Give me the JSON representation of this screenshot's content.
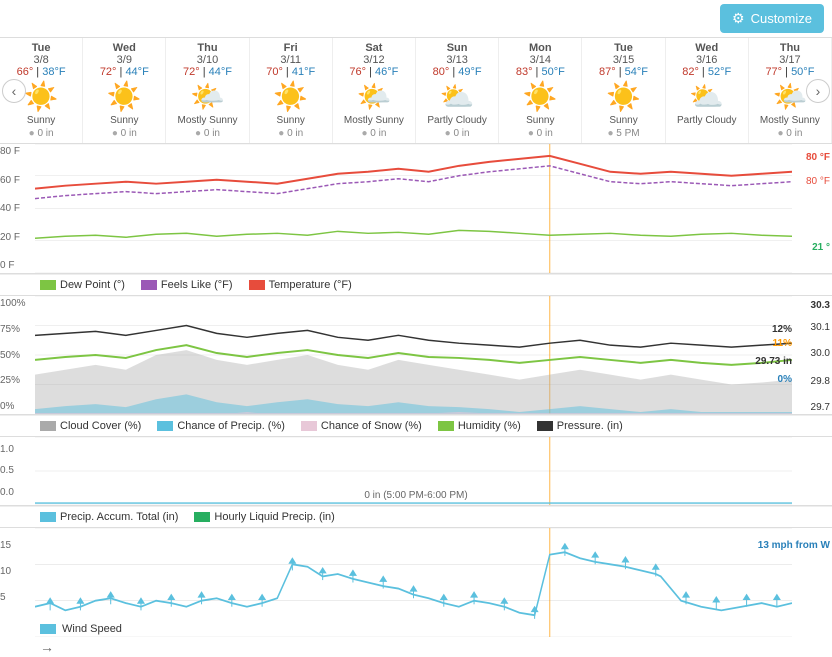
{
  "customize_button": "Customize",
  "days": [
    {
      "name": "Tue",
      "date": "3/8",
      "high": "66°",
      "low": "38°F",
      "icon": "☀️",
      "condition": "Sunny",
      "precip": "0 in"
    },
    {
      "name": "Wed",
      "date": "3/9",
      "high": "72°",
      "low": "44°F",
      "icon": "☀️",
      "condition": "Sunny",
      "precip": "0 in"
    },
    {
      "name": "Thu",
      "date": "3/10",
      "high": "72°",
      "low": "44°F",
      "icon": "🌤️",
      "condition": "Mostly Sunny",
      "precip": "0 in"
    },
    {
      "name": "Fri",
      "date": "3/11",
      "high": "70°",
      "low": "41°F",
      "icon": "☀️",
      "condition": "Sunny",
      "precip": "0 in"
    },
    {
      "name": "Sat",
      "date": "3/12",
      "high": "76°",
      "low": "46°F",
      "icon": "🌤️",
      "condition": "Mostly Sunny",
      "precip": "0 in"
    },
    {
      "name": "Sun",
      "date": "3/13",
      "high": "80°",
      "low": "49°F",
      "icon": "⛅",
      "condition": "Partly Cloudy",
      "precip": "0 in"
    },
    {
      "name": "Mon",
      "date": "3/14",
      "high": "83°",
      "low": "50°F",
      "icon": "☀️",
      "condition": "Sunny",
      "precip": "0 in"
    },
    {
      "name": "Tue",
      "date": "3/15",
      "high": "87°",
      "low": "54°F",
      "icon": "☀️",
      "condition": "Sunny",
      "precip": "5 PM"
    },
    {
      "name": "Wed",
      "date": "3/16",
      "high": "82°",
      "low": "52°F",
      "icon": "⛅",
      "condition": "Partly Cloudy",
      "precip": ""
    },
    {
      "name": "Thu",
      "date": "3/17",
      "high": "77°",
      "low": "50°F",
      "icon": "🌤️",
      "condition": "Mostly Sunny",
      "precip": "0 in"
    }
  ],
  "temp_chart": {
    "y_labels_left": [
      "80 F",
      "60 F",
      "40 F",
      "20 F",
      "0 F"
    ],
    "y_labels_right": [
      "80 °F",
      "",
      "",
      "21 °",
      ""
    ],
    "annotations": [
      {
        "text": "80 °F",
        "color": "#e74c3c"
      },
      {
        "text": "21 °",
        "color": "#27ae60"
      }
    ]
  },
  "legend1": [
    {
      "label": "Dew Point (°)",
      "color": "#7dc543",
      "type": "line"
    },
    {
      "label": "Feels Like (°F)",
      "color": "#9b59b6",
      "type": "line"
    },
    {
      "label": "Temperature (°F)",
      "color": "#e74c3c",
      "type": "line"
    }
  ],
  "precip_chart": {
    "y_labels_left": [
      "100%",
      "75%",
      "50%",
      "25%",
      "0%"
    ],
    "y_labels_right": [
      "30.3",
      "30.1",
      "30.0",
      "29.8",
      "29.7"
    ],
    "annotations": [
      {
        "text": "12%",
        "color": "#333"
      },
      {
        "text": "11%",
        "color": "#f90"
      },
      {
        "text": "29.73 in",
        "color": "#333"
      },
      {
        "text": "0%",
        "color": "#2980b9"
      }
    ]
  },
  "legend2": [
    {
      "label": "Cloud Cover (%)",
      "color": "#aaa",
      "type": "area"
    },
    {
      "label": "Chance of Precip. (%)",
      "color": "#5bc0de",
      "type": "area"
    },
    {
      "label": "Chance of Snow (%)",
      "color": "#e8c8d8",
      "type": "area"
    },
    {
      "label": "Humidity (%)",
      "color": "#7dc543",
      "type": "line"
    },
    {
      "label": "Pressure. (in)",
      "color": "#333",
      "type": "line"
    }
  ],
  "accum_chart": {
    "y_labels_left": [
      "1.0",
      "0.5",
      "0.0"
    ],
    "label": "0 in (5:00 PM-6:00 PM)"
  },
  "legend3": [
    {
      "label": "Precip. Accum. Total (in)",
      "color": "#5bc0de",
      "type": "line"
    },
    {
      "label": "Hourly Liquid Precip. (in)",
      "color": "#27ae60",
      "type": "line"
    }
  ],
  "wind_chart": {
    "y_labels_left": [
      "15",
      "10",
      "5"
    ],
    "annotation": "13 mph from W",
    "legend_label": "Wind Speed"
  },
  "bottom_arrow": "→"
}
